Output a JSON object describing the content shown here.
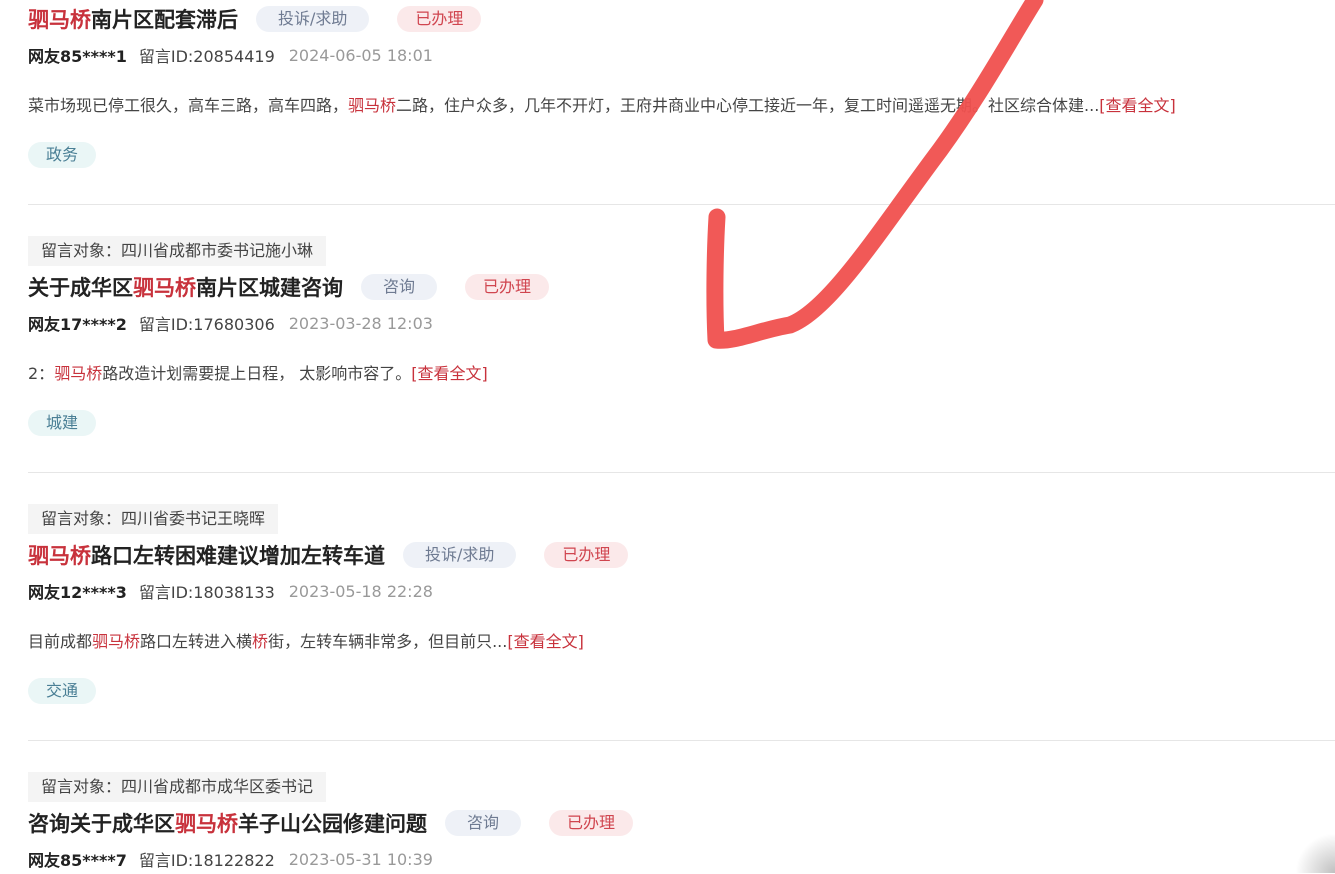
{
  "posts": [
    {
      "target": "",
      "title_hl": "驷马桥",
      "title_pre": "",
      "title_post": "南片区配套滞后",
      "type": "投诉/求助",
      "status": "已办理",
      "user": "网友85****1",
      "msg_id": "留言ID:20854419",
      "time": "2024-06-05 18:01",
      "content_a": "菜市场现已停工很久，高车三路，高车四路，",
      "content_hl": "驷马桥",
      "content_b": "二路，住户众多，几年不开灯，王府井商业中心停工接近一年，复工时间遥遥无期。社区综合体建...",
      "more": "[查看全文]",
      "tag": "政务"
    },
    {
      "target": "留言对象：四川省成都市委书记施小琳",
      "title_pre": "关于成华区",
      "title_hl": "驷马桥",
      "title_post": "南片区城建咨询",
      "type": "咨询",
      "status": "已办理",
      "user": "网友17****2",
      "msg_id": "留言ID:17680306",
      "time": "2023-03-28 12:03",
      "content_a": "2：",
      "content_hl": "驷马桥",
      "content_b": "路改造计划需要提上日程， 太影响市容了。",
      "more": "[查看全文]",
      "tag": "城建"
    },
    {
      "target": "留言对象：四川省委书记王晓晖",
      "title_pre": "",
      "title_hl": "驷马桥",
      "title_post": "路口左转困难建议增加左转车道",
      "type": "投诉/求助",
      "status": "已办理",
      "user": "网友12****3",
      "msg_id": "留言ID:18038133",
      "time": "2023-05-18 22:28",
      "content_a": "目前成都",
      "content_hl": "驷马桥",
      "content_b": "路口左转进入横",
      "content_hl2": "桥",
      "content_c": "街，左转车辆非常多，但目前只...",
      "more": "[查看全文]",
      "tag": "交通"
    },
    {
      "target": "留言对象：四川省成都市成华区委书记",
      "title_pre": "咨询关于成华区",
      "title_hl": "驷马桥",
      "title_post": "羊子山公园修建问题",
      "type": "咨询",
      "status": "已办理",
      "user": "网友85****7",
      "msg_id": "留言ID:18122822",
      "time": "2023-05-31 10:39"
    }
  ],
  "colors": {
    "highlight": "#c8323c",
    "annotation_stroke": "#f0504e"
  }
}
